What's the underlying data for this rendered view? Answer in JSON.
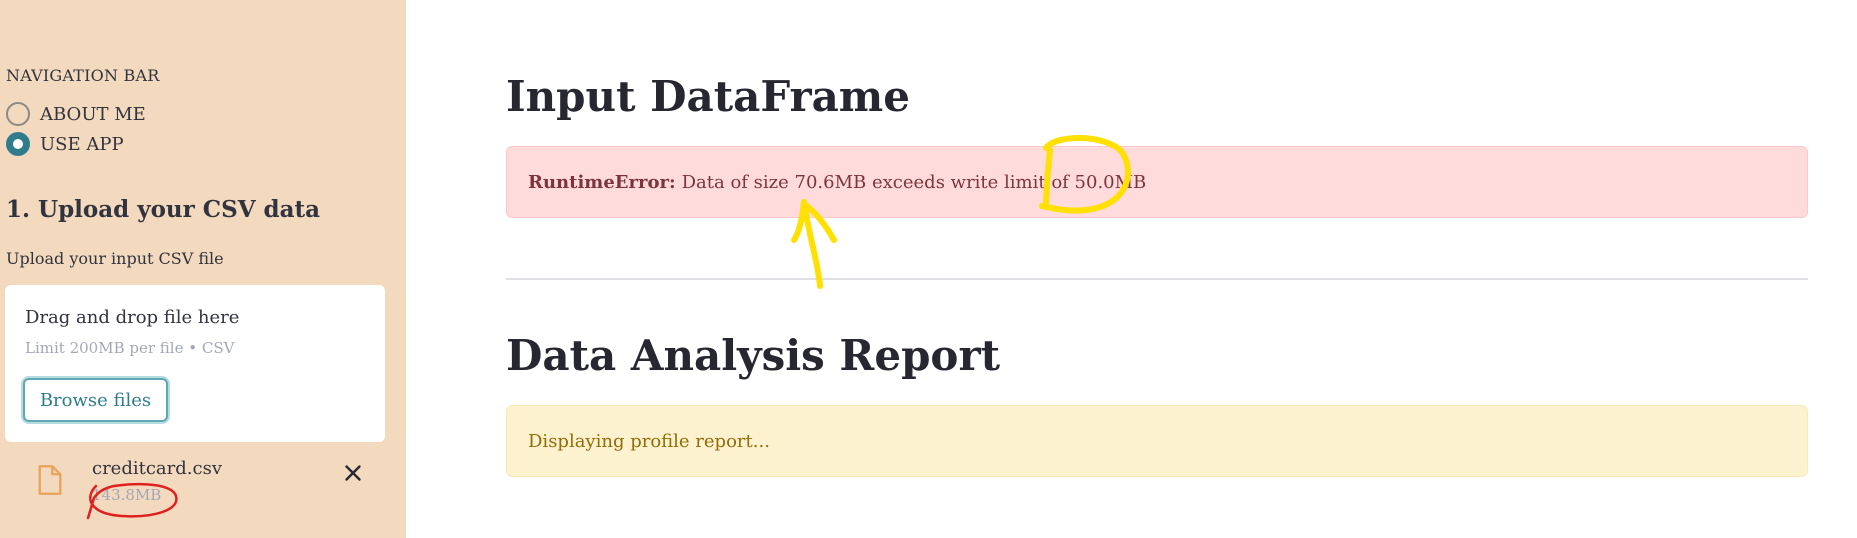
{
  "sidebar": {
    "nav_label": "NAVIGATION BAR",
    "radio_options": [
      {
        "label": "ABOUT ME",
        "selected": false
      },
      {
        "label": "USE APP",
        "selected": true
      }
    ],
    "section_title": "1. Upload your CSV data",
    "upload_label": "Upload your input CSV file",
    "dropzone": {
      "drag_text": "Drag and drop file here",
      "limit_text": "Limit 200MB per file • CSV",
      "browse_label": "Browse files"
    },
    "uploaded_file": {
      "name": "creditcard.csv",
      "size": "143.8MB",
      "icon": "file-icon",
      "remove_icon": "close-icon"
    }
  },
  "main": {
    "input_title": "Input DataFrame",
    "error": {
      "type": "RuntimeError:",
      "message": "Data of size 70.6MB exceeds write limit of 50.0MB"
    },
    "report_title": "Data Analysis Report",
    "status_message": "Displaying profile report..."
  },
  "colors": {
    "sidebar_bg": "#f3d9bd",
    "accent": "#2e7d8c",
    "error_bg": "#ffdbdb",
    "warning_bg": "#fdf2d0",
    "annotation_yellow": "#ffe000",
    "annotation_red": "#e0201c"
  }
}
